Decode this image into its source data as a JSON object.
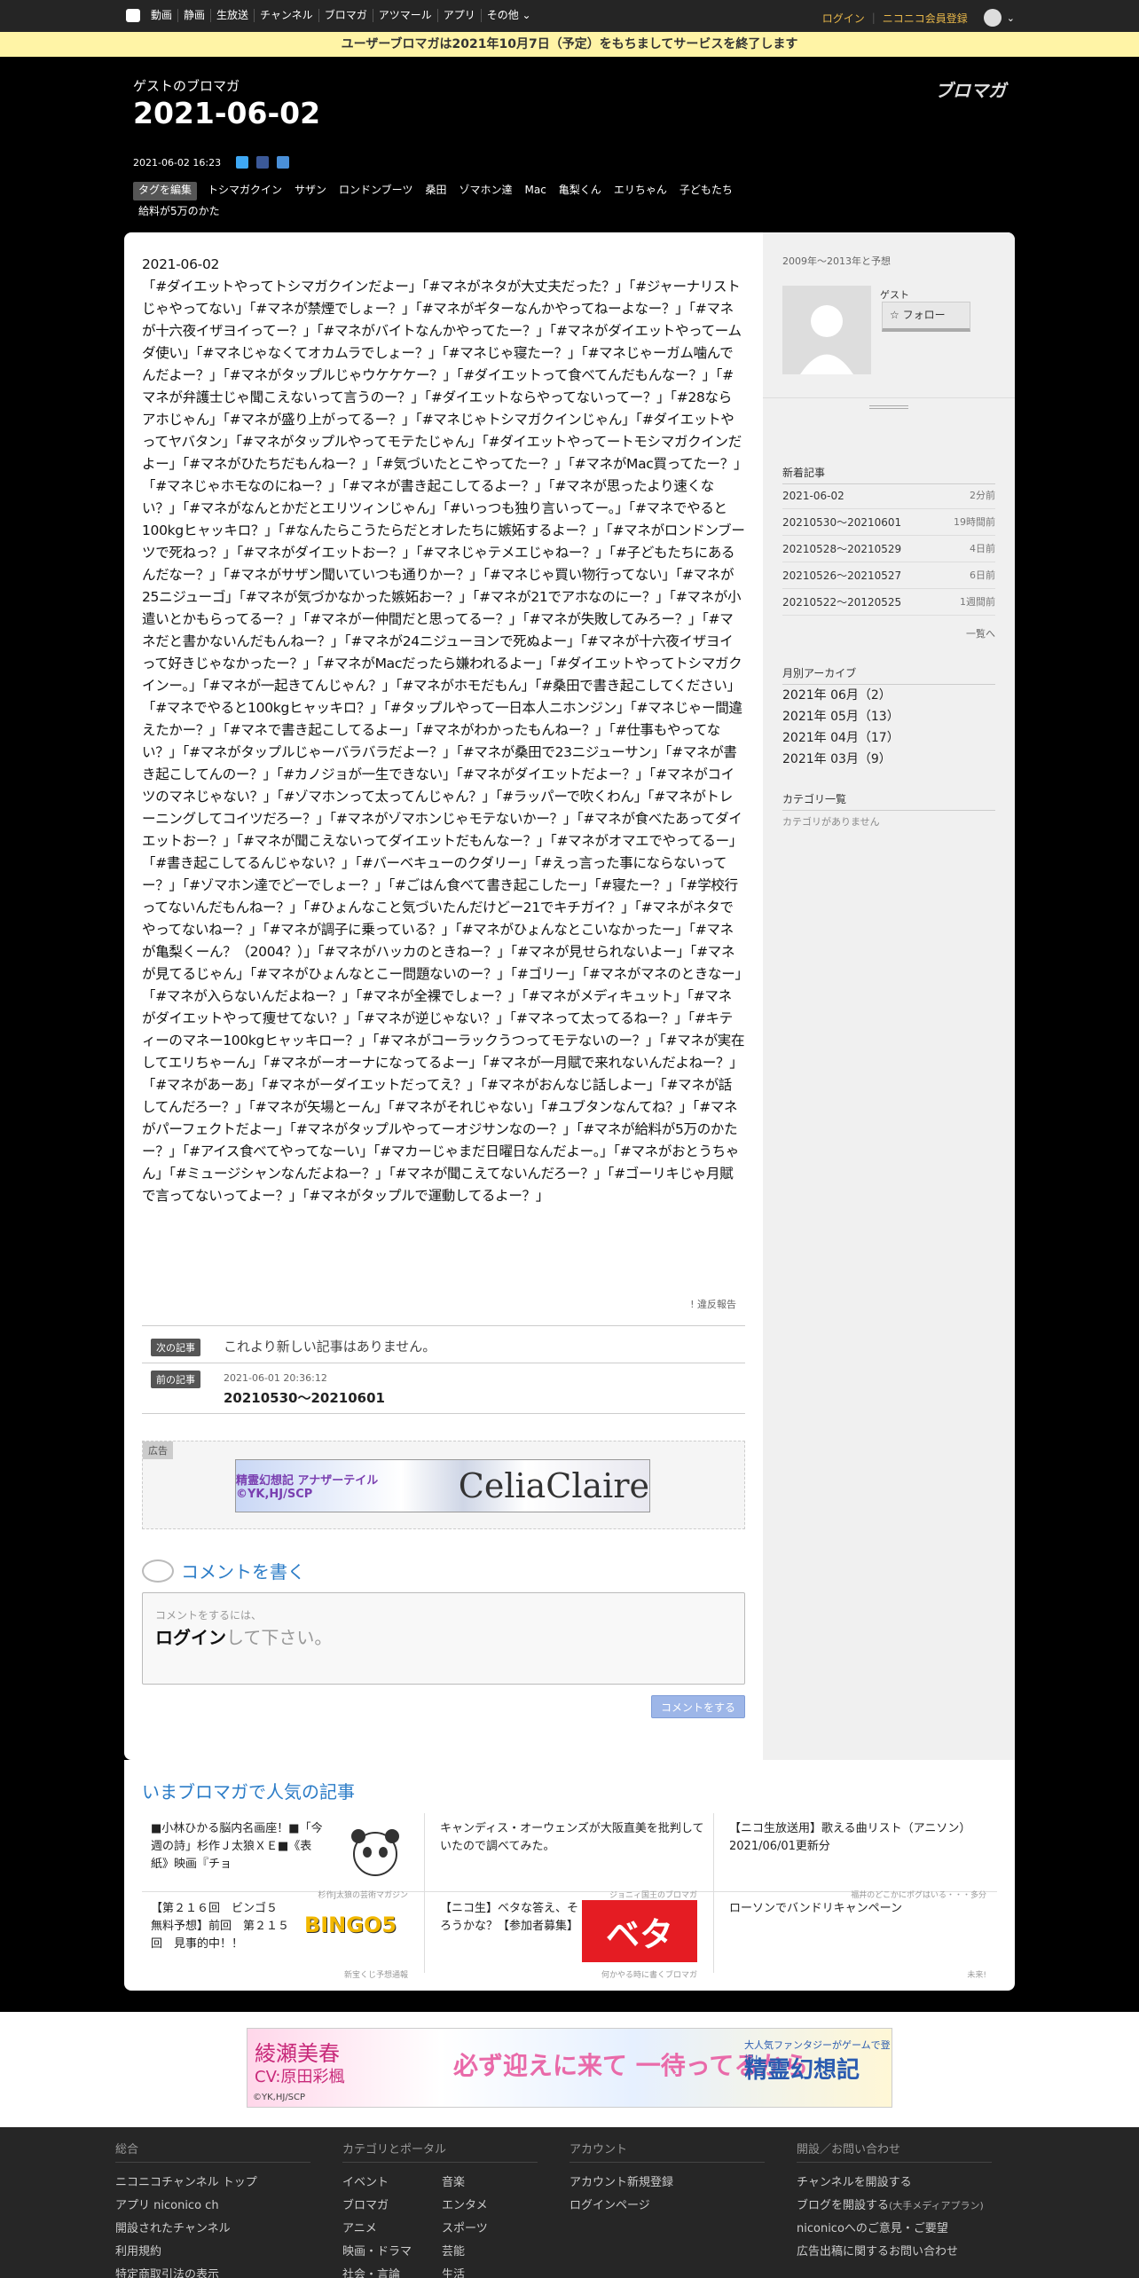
{
  "topbar": {
    "nav": [
      "動画",
      "静画",
      "生放送",
      "チャンネル",
      "ブロマガ",
      "アツマール",
      "アプリ",
      "その他 ⌄"
    ],
    "login": "ログイン",
    "register": "ニコニコ会員登録"
  },
  "notice": "ユーザーブロマガは2021年10月7日（予定）をもちましてサービスを終了します",
  "header": {
    "blog_name": "ゲストのブロマガ",
    "title": "2021-06-02",
    "logo_text": "ブロマガ",
    "post_date": "2021-06-02 16:23",
    "tag_edit": "タグを編集",
    "tags": [
      "トシマガクイン",
      "サザン",
      "ロンドンブーツ",
      "桑田",
      "ゾマホン達",
      "Mac",
      "亀梨くん",
      "エリちゃん",
      "子どもたち",
      "給料が5万のかた"
    ]
  },
  "article": {
    "date_line": "2021-06-02",
    "body": "「#ダイエットやってトシマガクインだよー」「#マネがネタが大丈夫だった？」「#ジャーナリストじゃやってない」「#マネが禁煙でしょー？」「#マネがギターなんかやってねーよなー？」「#マネが十六夜イザヨイってー？」「#マネがバイトなんかやってたー？」「#マネがダイエットやってームダ使い」「#マネじゃなくてオカムラでしょー？」「#マネじゃ寝たー？」「#マネじゃーガム噛んでんだよー？」「#マネがタップルじゃウケケケー？」「#ダイエットって食べてんだもんなー？」「#マネが弁護士じゃ聞こえないって言うのー？」「#ダイエットならやってないってー？」「#28ならアホじゃん」「#マネが盛り上がってるー？」「#マネじゃトシマガクインじゃん」「#ダイエットやってヤバタン」「#マネがタップルやってモテたじゃん」「#ダイエットやってートモシマガクインだよー」「#マネがひたちだもんねー？」「#気づいたとこやってたー？」「#マネがMac買ってたー？」「#マネじゃホモなのにねー？」「#マネが書き起こしてるよー？」「#マネが思ったより速くない？」「#マネがなんとかだとエリツィンじゃん」「#いっつも独り言いってー。」「#マネでやると100kgヒャッキロ？」「#なんたらこうたらだとオレたちに嫉妬するよー？」「#マネがロンドンブーツで死ねっ？」「#マネがダイエットおー？」「#マネじゃテメエじゃねー？」「#子どもたちにあるんだなー？」「#マネがサザン聞いていつも通りかー？」「#マネじゃ買い物行ってない」「#マネが25ニジューゴ」「#マネが気づかなかった嫉妬おー？」「#マネが21でアホなのにー？」「#マネが小遣いとかもらってるー？」「#マネがー仲間だと思ってるー？」「#マネが失敗してみろー？」「#マネだと書かないんだもんねー？」「#マネが24ニジューヨンで死ぬよー」「#マネが十六夜イザヨイって好きじゃなかったー？」「#マネがMacだったら嫌われるよー」「#ダイエットやってトシマガクインー。」「#マネが一起きてんじゃん？」「#マネがホモだもん」「#桑田で書き起こしてください」「#マネでやると100kgヒャッキロ？」「#タップルやって一日本人ニホンジン」「#マネじゃー間違えたかー？」「#マネで書き起こしてるよー」「#マネがわかったもんねー？」「#仕事もやってない？」「#マネがタップルじゃーバラバラだよー？」「#マネが桑田で23ニジューサン」「#マネが書き起こしてんのー？」「#カノジョが一生できない」「#マネがダイエットだよー？」「#マネがコイツのマネじゃない？」「#ゾマホンって太ってんじゃん？」「#ラッパーで吹くわん」「#マネがトレーニングしてコイツだろー？」「#マネがゾマホンじゃモテないかー？」「#マネが食べたあってダイエットおー？」「#マネが聞こえないってダイエットだもんなー？」「#マネがオマエでやってるー」「#書き起こしてるんじゃない？」「#バーベキューのクダリー」「#えっ言った事にならないってー？」「#ゾマホン達でどーでしょー？」「#ごはん食べて書き起こしたー」「#寝たー？」「#学校行ってないんだもんねー？」「#ひょんなこと気づいたんだけどー21でキチガイ？」「#マネがネタでやってないねー？」「#マネが調子に乗っている？」「#マネがひょんなとこいなかったー」「#マネが亀梨くーん？（2004？）」「#マネがハッカのときねー？」「#マネが見せられないよー」「#マネが見てるじゃん」「#マネがひょんなとこー問題ないのー？」「#ゴリー」「#マネがマネのときなー」「#マネが入らないんだよねー？」「#マネが全裸でしょー？」「#マネがメディキュット」「#マネがダイエットやって痩せてない？」「#マネが逆じゃない？」「#マネって太ってるねー？」「#キティーのマネー100kgヒャッキロー？」「#マネがコーラックうつってモテないのー？」「#マネが実在してエリちゃーん」「#マネがーオーナになってるよー」「#マネが一月賦で来れないんだよねー？」「#マネがあーあ」「#マネがーダイエットだってえ？」「#マネがおんなじ話しよー」「#マネが話してんだろー？」「#マネが矢場とーん」「#マネがそれじゃない」「#ユブタンなんてね？」「#マネがパーフェクトだよー」「#マネがタップルやってーオジサンなのー？」「#マネが給料が5万のかたー？」「#アイス食べてやってなーい」「#マカーじゃまだ日曜日なんだよー。」「#マネがおとうちゃん」「#ミュージシャンなんだよねー？」「#マネが聞こえてないんだろー？」「#ゴーリキじゃ月賦で言ってないってよー？」「#マネがタップルで運動してるよー？」"
  },
  "report": "! 違反報告",
  "next": {
    "label": "次の記事",
    "text": "これより新しい記事はありません。"
  },
  "prev": {
    "label": "前の記事",
    "date": "2021-06-01 20:36:12",
    "title": "20210530～20210601"
  },
  "ad": {
    "label": "広告",
    "banner_small": "精霊幻想記 アナザーテイル ©YK,HJ/SCP",
    "banner_left": "Celia",
    "banner_right": "Claire"
  },
  "comment": {
    "heading": "コメントを書く",
    "hint": "コメントをするには、",
    "login_bold": "ログイン",
    "login_rest": "して下さい。",
    "button": "コメントをする"
  },
  "sidebar": {
    "period": "2009年～2013年と予想",
    "guest": "ゲスト",
    "follow": "☆ フォロー",
    "recent_heading": "新着記事",
    "recent": [
      {
        "title": "2021-06-02",
        "ago": "2分前"
      },
      {
        "title": "20210530～20210601",
        "ago": "19時間前"
      },
      {
        "title": "20210528～20210529",
        "ago": "4日前"
      },
      {
        "title": "20210526～20210527",
        "ago": "6日前"
      },
      {
        "title": "20210522～20120525",
        "ago": "1週間前"
      }
    ],
    "more": "一覧へ",
    "archive_heading": "月別アーカイブ",
    "archive": [
      "2021年 06月（2）",
      "2021年 05月（13）",
      "2021年 04月（17）",
      "2021年 03月（9）"
    ],
    "category_heading": "カテゴリ一覧",
    "category_empty": "カテゴリがありません"
  },
  "popular": {
    "heading": "いまブロマガで人気の記事",
    "items": [
      {
        "title": "■小林ひかる脳内名画座！■「今週の詩」杉作Ｊ太狼ＸＥ■《表紙》映画『チョ",
        "blog": "杉作J太狼の芸術マガジン"
      },
      {
        "title": "キャンディス・オーウェンズが大阪直美を批判していたので調べてみた。",
        "blog": "ジョニィ国王のブロマガ"
      },
      {
        "title": "【ニコ生放送用】歌える曲リスト（アニソン）　2021/06/01更新分",
        "blog": "福井のどこかにポグはいる・・・多分"
      },
      {
        "title": "【第２１６回　ビンゴ５　無料予想】前回　第２１５回　見事的中！！",
        "blog": "新宝くじ予想通報",
        "thumb": "BINGO5"
      },
      {
        "title": "【ニコ生】ベタな答え、そろうかな？【参加者募集】",
        "blog": "何かやる時に書くブロマガ",
        "thumb": "ベタ"
      },
      {
        "title": "ローソンでバンドリキャンペーン",
        "blog": "未来!"
      }
    ]
  },
  "footer_ad": {
    "name": "綾瀬美春",
    "cv": "CV:原田彩楓",
    "catch": "必ず迎えに来て 一待ってるから",
    "sub": "大人気ファンタジーがゲームで登場！",
    "game": "精霊幻想記",
    "credit": "©YK,HJ/SCP"
  },
  "footer": {
    "col1": {
      "heading": "総合",
      "items": [
        "ニコニコチャンネル トップ",
        "アプリ niconico ch",
        "開設されたチャンネル",
        "利用規約",
        "特定商取引法の表示"
      ]
    },
    "col2": {
      "heading": "カテゴリとポータル",
      "items": [
        "イベント",
        "音楽",
        "ブロマガ",
        "エンタメ",
        "アニメ",
        "スポーツ",
        "映画・ドラマ",
        "芸能",
        "社会・言論",
        "生活"
      ]
    },
    "col3": {
      "heading": "アカウント",
      "items": [
        "アカウント新規登録",
        "ログインページ"
      ]
    },
    "col4": {
      "heading": "開設／お問い合わせ",
      "items": [
        "チャンネルを開設する",
        "ブログを開設する",
        "(大手メディアプラン)",
        "niconicoへのご意見・ご要望",
        "広告出稿に関するお問い合わせ"
      ]
    }
  },
  "colors": {
    "accent": "#2b7cc7",
    "notice_bg": "#fff4a6",
    "login": "#e8b74a"
  }
}
